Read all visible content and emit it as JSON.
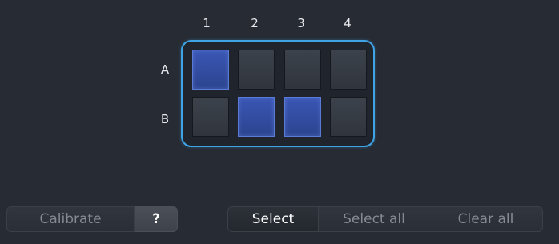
{
  "plate": {
    "columns": [
      "1",
      "2",
      "3",
      "4"
    ],
    "rows": [
      "A",
      "B"
    ],
    "wells": [
      {
        "id": "A1",
        "selected": true
      },
      {
        "id": "A2",
        "selected": false
      },
      {
        "id": "A3",
        "selected": false
      },
      {
        "id": "A4",
        "selected": false
      },
      {
        "id": "B1",
        "selected": false
      },
      {
        "id": "B2",
        "selected": true
      },
      {
        "id": "B3",
        "selected": true
      },
      {
        "id": "B4",
        "selected": false
      }
    ],
    "selected_color": "#3a56b4",
    "outline_color": "#3ea4e6"
  },
  "buttons": {
    "calibrate": "Calibrate",
    "help": "?"
  },
  "selection": {
    "select": "Select",
    "select_all": "Select all",
    "clear_all": "Clear all",
    "active": "select"
  }
}
